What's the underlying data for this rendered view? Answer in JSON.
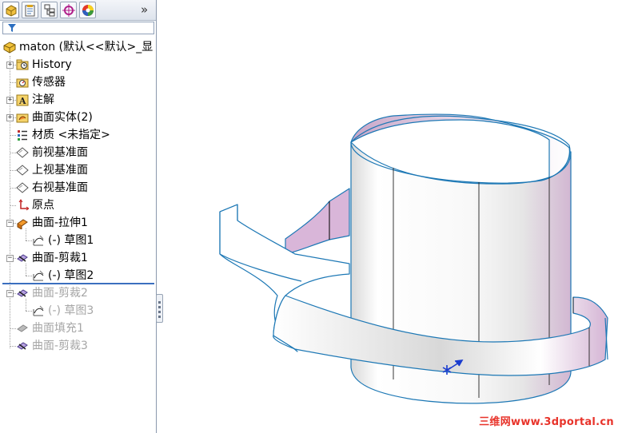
{
  "feature_manager": {
    "tabs": [
      {
        "name": "featuremanager-tab",
        "icon": "feature-tree-icon"
      },
      {
        "name": "propertymanager-tab",
        "icon": "property-manager-icon"
      },
      {
        "name": "configurationmanager-tab",
        "icon": "configuration-manager-icon"
      },
      {
        "name": "dimxpert-tab",
        "icon": "dimxpert-icon"
      },
      {
        "name": "display-manager-tab",
        "icon": "appearance-icon"
      }
    ],
    "more_glyph": "»",
    "filter_icon": "filter-icon",
    "root": {
      "label": "maton  (默认<<默认>_显",
      "icon": "part-icon"
    },
    "items": [
      {
        "label": "History",
        "icon": "history-folder-icon",
        "expandable": true,
        "indent": 1,
        "disabled": false
      },
      {
        "label": "传感器",
        "icon": "sensor-icon",
        "expandable": false,
        "indent": 1,
        "disabled": false
      },
      {
        "label": "注解",
        "icon": "annotation-icon",
        "expandable": true,
        "indent": 1,
        "disabled": false
      },
      {
        "label": "曲面实体(2)",
        "icon": "surface-bodies-icon",
        "expandable": true,
        "indent": 1,
        "disabled": false
      },
      {
        "label": "材质 <未指定>",
        "icon": "material-icon",
        "expandable": false,
        "indent": 1,
        "disabled": false
      },
      {
        "label": "前视基准面",
        "icon": "plane-icon",
        "expandable": false,
        "indent": 1,
        "disabled": false
      },
      {
        "label": "上视基准面",
        "icon": "plane-icon",
        "expandable": false,
        "indent": 1,
        "disabled": false
      },
      {
        "label": "右视基准面",
        "icon": "plane-icon",
        "expandable": false,
        "indent": 1,
        "disabled": false
      },
      {
        "label": "原点",
        "icon": "origin-icon",
        "expandable": false,
        "indent": 1,
        "disabled": false
      },
      {
        "label": "曲面-拉伸1",
        "icon": "surface-extrude-icon",
        "expandable": true,
        "expanded": true,
        "indent": 1,
        "disabled": false
      },
      {
        "label": "(-) 草图1",
        "icon": "sketch-icon",
        "expandable": false,
        "indent": 2,
        "disabled": false
      },
      {
        "label": "曲面-剪裁1",
        "icon": "surface-trim-icon",
        "expandable": true,
        "expanded": true,
        "indent": 1,
        "disabled": false
      },
      {
        "label": "(-) 草图2",
        "icon": "sketch-icon",
        "expandable": false,
        "indent": 2,
        "disabled": false
      },
      {
        "label": "曲面-剪裁2",
        "icon": "surface-trim-icon",
        "expandable": true,
        "expanded": true,
        "indent": 1,
        "disabled": true
      },
      {
        "label": "(-) 草图3",
        "icon": "sketch-icon",
        "expandable": false,
        "indent": 2,
        "disabled": true
      },
      {
        "label": "曲面填充1",
        "icon": "surface-fill-icon",
        "expandable": false,
        "indent": 1,
        "disabled": true
      },
      {
        "label": "曲面-剪裁3",
        "icon": "surface-trim-icon",
        "expandable": false,
        "indent": 1,
        "disabled": true
      }
    ]
  },
  "viewport": {
    "model_name": "cup-with-handle-surface-model",
    "triad_icon": "coordinate-triad-icon"
  },
  "watermark": "三维网www.3dportal.cn",
  "colors": {
    "edge": "#1d78b5",
    "surface_light": "#ffffff",
    "surface_pink": "#d9b6d9",
    "watermark": "#e8332a",
    "rollback_bar": "#3b6fbf"
  }
}
